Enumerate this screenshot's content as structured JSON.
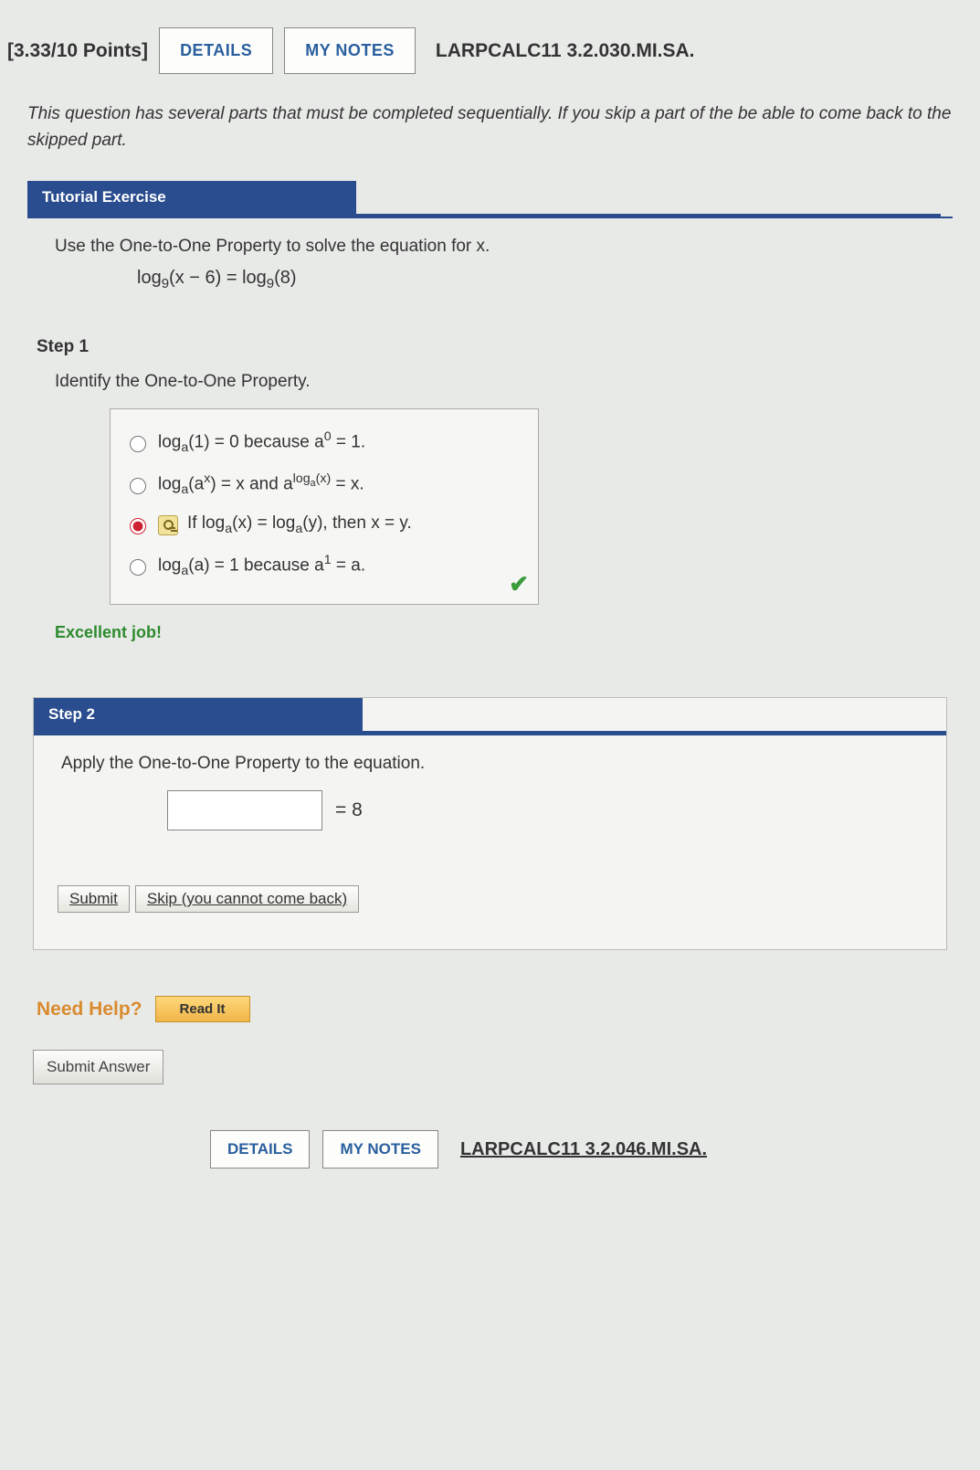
{
  "header": {
    "points": "[3.33/10 Points]",
    "details_btn": "DETAILS",
    "notes_btn": "MY NOTES",
    "qid": "LARPCALC11 3.2.030.MI.SA."
  },
  "intro": "This question has several parts that must be completed sequentially. If you skip a part of the be able to come back to the skipped part.",
  "tutorial_tab": "Tutorial Exercise",
  "exercise_prompt": "Use the One-to-One Property to solve the equation for x.",
  "equation_html": "log<sub>9</sub>(x − 6) = log<sub>9</sub>(8)",
  "step1": {
    "title": "Step 1",
    "prompt": "Identify the One-to-One Property.",
    "options": [
      "log<sub>a</sub>(1) = 0 because a<sup>0</sup> = 1.",
      "log<sub>a</sub>(a<sup>x</sup>) = x and a<sup>log<sub>a</sub>(x)</sup> = x.",
      "If log<sub>a</sub>(x) = log<sub>a</sub>(y), then x = y.",
      "log<sub>a</sub>(a) = 1 because a<sup>1</sup> = a."
    ],
    "selected_index": 2,
    "feedback": "Excellent job!"
  },
  "step2": {
    "tab": "Step 2",
    "prompt": "Apply the One-to-One Property to the equation.",
    "rhs": "= 8",
    "input_value": "",
    "submit": "Submit",
    "skip": "Skip (you cannot come back)"
  },
  "need_help": {
    "label": "Need Help?",
    "read_it": "Read It"
  },
  "submit_answer": "Submit Answer",
  "footer": {
    "details_btn": "DETAILS",
    "notes_btn": "MY NOTES",
    "qid": "LARPCALC11 3.2.046.MI.SA."
  }
}
